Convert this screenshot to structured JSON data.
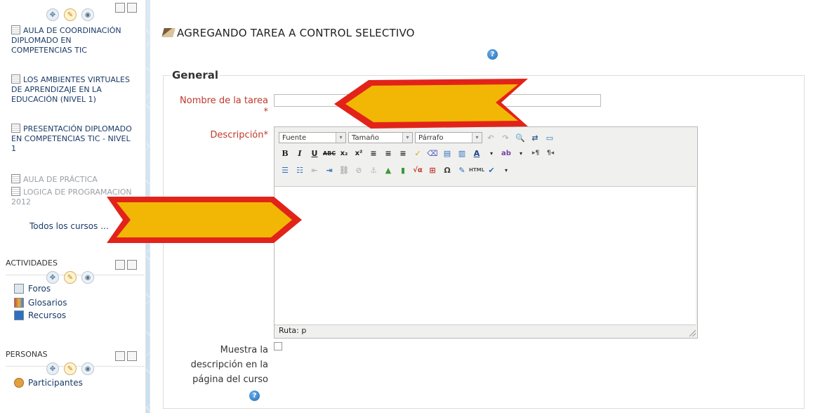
{
  "sidebar": {
    "courses": [
      {
        "label": "AULA DE COORDINACIÓN DIPLOMADO EN COMPETENCIAS TIC",
        "dim": false
      },
      {
        "label": "LOS AMBIENTES VIRTUALES DE APRENDIZAJE EN LA EDUCACIÓN (NIVEL 1)",
        "dim": false
      },
      {
        "label": "PRESENTACIÓN DIPLOMADO EN COMPETENCIAS TIC - NIVEL 1",
        "dim": false
      },
      {
        "label": "AULA DE PRÁCTICA",
        "dim": true
      },
      {
        "label": "LOGICA DE PROGRAMACION 2012",
        "dim": true
      }
    ],
    "all_courses_link": "Todos los cursos ...",
    "activities": {
      "title": "ACTIVIDADES",
      "items": [
        "Foros",
        "Glosarios",
        "Recursos"
      ]
    },
    "people": {
      "title": "PERSONAS",
      "items": [
        "Participantes"
      ]
    }
  },
  "main": {
    "heading": "AGREGANDO TAREA A CONTROL SELECTIVO",
    "legend": "General",
    "task_name_label": "Nombre de la tarea",
    "required_mark": "*",
    "task_name_value": "",
    "description_label": "Descripción*",
    "show_desc_label": "Muestra la descripción en la página del curso",
    "help_glyph": "?",
    "editor": {
      "font_select": "Fuente",
      "size_select": "Tamaño",
      "format_select": "Párrafo",
      "path": "Ruta: p"
    }
  },
  "colors": {
    "required": "#c0392b",
    "link": "#1a3b66",
    "arrow_fill": "#f2b705",
    "arrow_border": "#e2231a"
  }
}
